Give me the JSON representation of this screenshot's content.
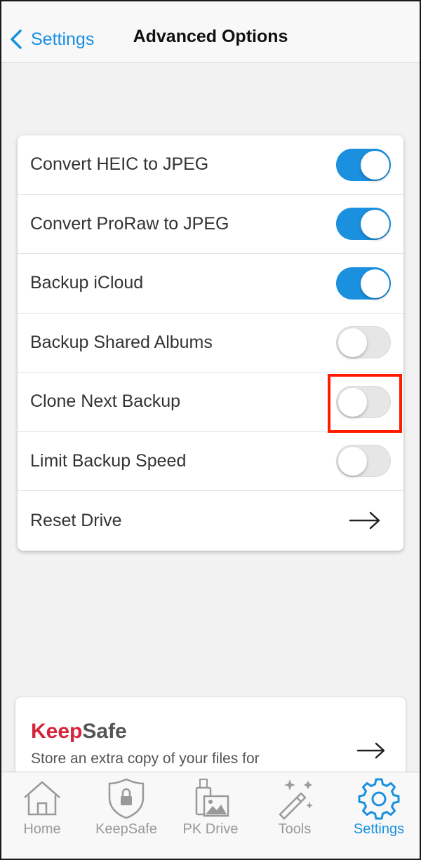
{
  "header": {
    "back_label": "Settings",
    "title": "Advanced Options"
  },
  "options": [
    {
      "label": "Convert HEIC to JPEG",
      "control": "toggle",
      "on": true
    },
    {
      "label": "Convert ProRaw to JPEG",
      "control": "toggle",
      "on": true
    },
    {
      "label": "Backup iCloud",
      "control": "toggle",
      "on": true
    },
    {
      "label": "Backup Shared Albums",
      "control": "toggle",
      "on": false
    },
    {
      "label": "Clone Next Backup",
      "control": "toggle",
      "on": false
    },
    {
      "label": "Limit Backup Speed",
      "control": "toggle",
      "on": false
    },
    {
      "label": "Reset Drive",
      "control": "arrow"
    }
  ],
  "keepsafe_card": {
    "title_part1": "Keep",
    "title_part2": "Safe",
    "description": "Store an extra copy of your files for"
  },
  "tabbar": {
    "tabs": [
      {
        "label": "Home",
        "icon": "home-icon",
        "active": false
      },
      {
        "label": "KeepSafe",
        "icon": "shield-lock-icon",
        "active": false
      },
      {
        "label": "PK Drive",
        "icon": "drive-photo-icon",
        "active": false
      },
      {
        "label": "Tools",
        "icon": "magic-wand-icon",
        "active": false
      },
      {
        "label": "Settings",
        "icon": "gear-icon",
        "active": true
      }
    ]
  },
  "colors": {
    "accent": "#1a90df",
    "highlight": "#ff1a00",
    "brand_red": "#d6243a"
  }
}
